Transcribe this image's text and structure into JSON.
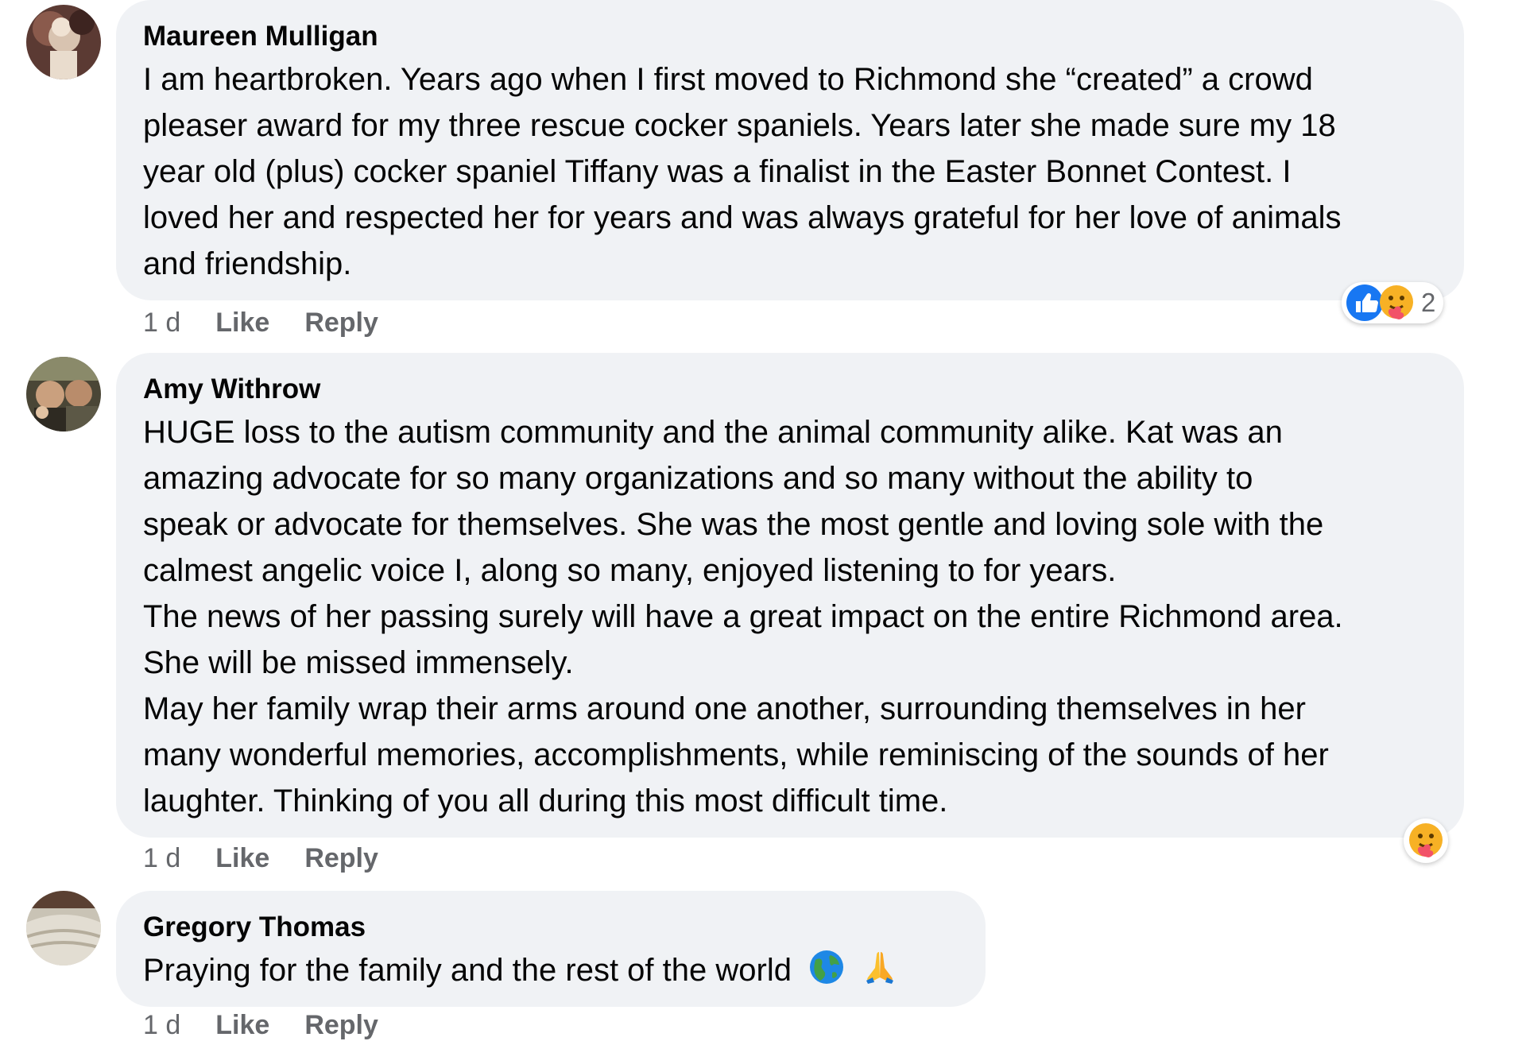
{
  "comments": [
    {
      "author": "Maureen Mulligan",
      "lines": [
        "I am heartbroken. Years ago when I first moved to Richmond she “created” a crowd",
        "pleaser award for my three rescue cocker spaniels. Years later she made sure my 18",
        "year old (plus) cocker spaniel Tiffany was a finalist in the Easter Bonnet Contest. I",
        "loved her and respected her for years and was always grateful for her love of animals",
        "and friendship."
      ],
      "time": "1 d",
      "like_label": "Like",
      "reply_label": "Reply",
      "reactions": {
        "icons": [
          "like-icon",
          "care-icon"
        ],
        "count": "2"
      }
    },
    {
      "author": "Amy Withrow",
      "lines": [
        "HUGE loss to the autism community and the animal community alike. Kat was an",
        "amazing advocate for so many organizations and so many without the ability to",
        "speak or advocate for themselves. She was the most gentle and loving sole with the",
        "calmest angelic voice I, along so many, enjoyed listening to for years.",
        "The news of her passing surely will have a great impact on the entire Richmond area.",
        "She will be missed immensely.",
        "May her family wrap their arms around one another, surrounding themselves in her",
        "many wonderful memories, accomplishments, while reminiscing of the sounds of her",
        "laughter. Thinking of you all during this most difficult time."
      ],
      "time": "1 d",
      "like_label": "Like",
      "reply_label": "Reply",
      "reactions": {
        "icons": [
          "care-icon"
        ]
      }
    },
    {
      "author": "Gregory Thomas",
      "lines": [
        "Praying for the family and the rest of the world"
      ],
      "emojis": [
        "globe-icon",
        "praying-hands-icon"
      ],
      "time": "1 d",
      "like_label": "Like",
      "reply_label": "Reply"
    }
  ],
  "colors": {
    "bubble": "#f0f2f5",
    "text": "#050505",
    "secondary": "#65676b",
    "like_blue": "#1877f2",
    "care_yellow": "#f7b125"
  }
}
